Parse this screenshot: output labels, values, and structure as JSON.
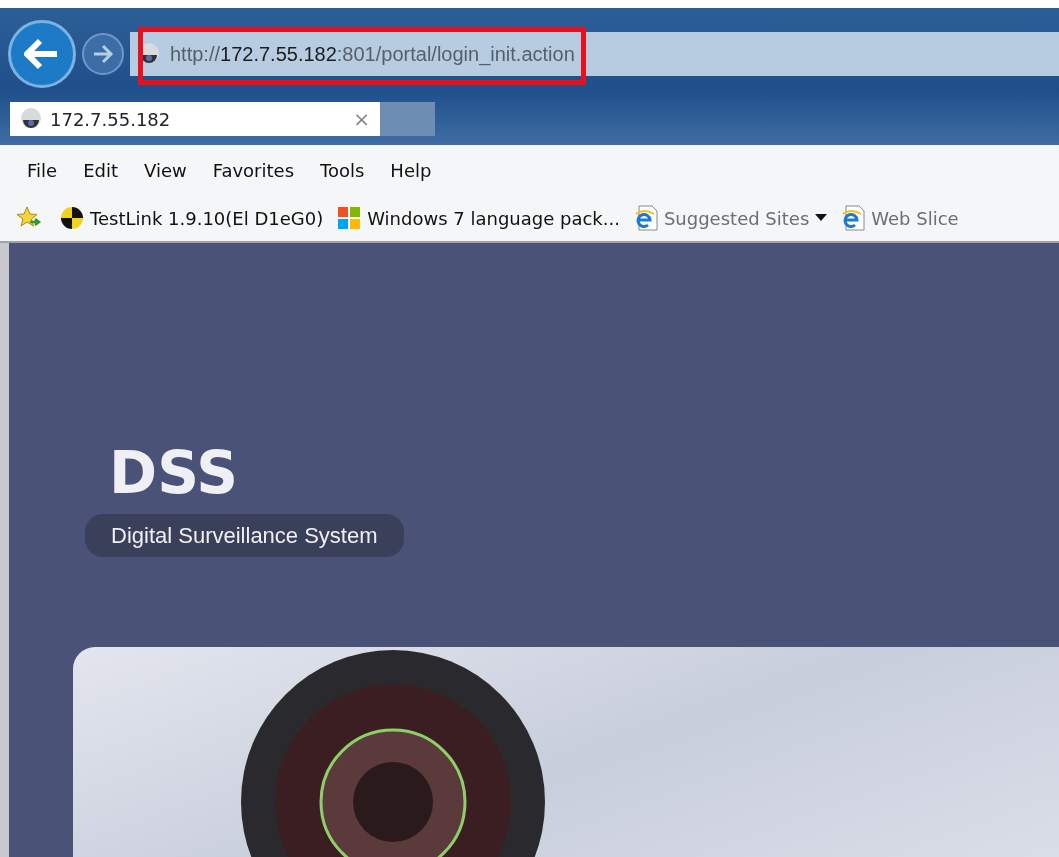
{
  "address_bar": {
    "scheme": "http://",
    "host": "172.7.55.182",
    "rest": ":801/portal/login_init.action"
  },
  "tabs": [
    {
      "title": "172.7.55.182",
      "close": "×",
      "selected": true
    }
  ],
  "menu": [
    "File",
    "Edit",
    "View",
    "Favorites",
    "Tools",
    "Help"
  ],
  "favorites": [
    {
      "label": "TestLink 1.9.10(El D1eG0)",
      "kind": "testlink",
      "dropdown": false
    },
    {
      "label": "Windows 7 language pack...",
      "kind": "windows",
      "dropdown": false
    },
    {
      "label": "Suggested Sites",
      "kind": "ie",
      "dropdown": true
    },
    {
      "label": "Web Slice",
      "kind": "ie",
      "dropdown": false
    }
  ],
  "page": {
    "title": "DSS",
    "subtitle": "Digital Surveillance System"
  }
}
